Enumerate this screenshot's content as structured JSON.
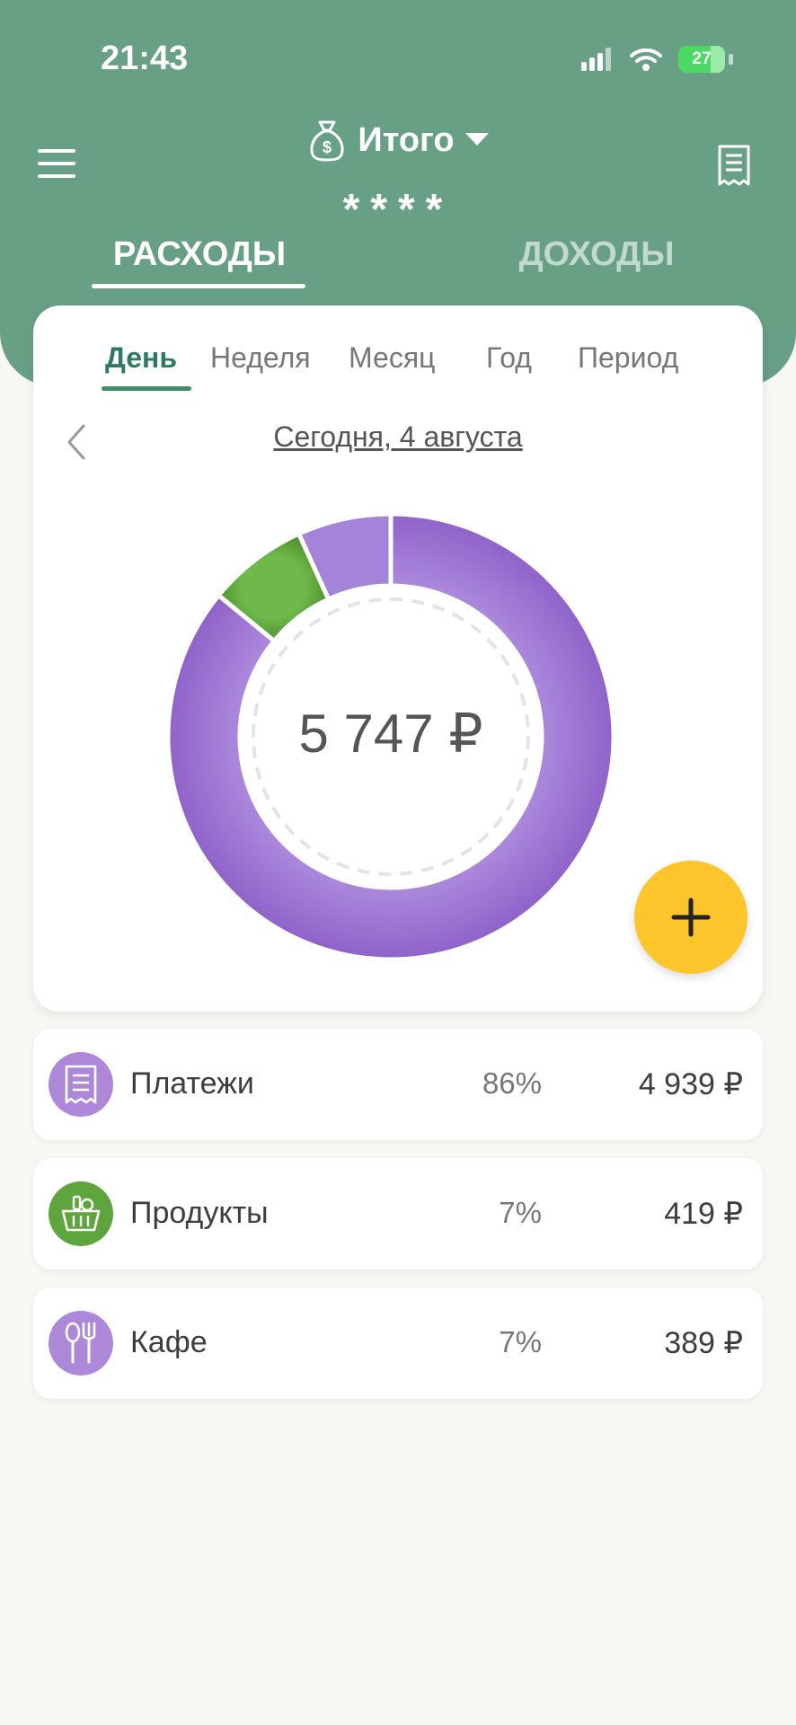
{
  "status_bar": {
    "time": "21:43",
    "battery": "27"
  },
  "header": {
    "account_name": "Итого",
    "balance_masked": "****",
    "tabs": [
      {
        "label": "РАСХОДЫ",
        "active": true
      },
      {
        "label": "ДОХОДЫ",
        "active": false
      }
    ]
  },
  "periods": [
    {
      "label": "День",
      "active": true
    },
    {
      "label": "Неделя",
      "active": false
    },
    {
      "label": "Месяц",
      "active": false
    },
    {
      "label": "Год",
      "active": false
    },
    {
      "label": "Период",
      "active": false
    }
  ],
  "date_label": "Сегодня, 4 августа",
  "total": "5 747 ₽",
  "categories": [
    {
      "name": "Платежи",
      "percent": "86%",
      "amount": "4 939 ₽",
      "color": "#ad88d8",
      "icon": "receipt-icon"
    },
    {
      "name": "Продукты",
      "percent": "7%",
      "amount": "419 ₽",
      "color": "#5ea53d",
      "icon": "grocery-basket-icon"
    },
    {
      "name": "Кафе",
      "percent": "7%",
      "amount": "389 ₽",
      "color": "#ad88d8",
      "icon": "cutlery-icon"
    }
  ],
  "chart_data": {
    "type": "pie",
    "categories": [
      "Платежи",
      "Продукты",
      "Кафе"
    ],
    "values": [
      4939,
      419,
      389
    ],
    "colors": [
      "#9b72d0",
      "#5a9e3a",
      "#a07dd4"
    ]
  },
  "colors": {
    "header": "#67a085",
    "accent": "#2e7a5c",
    "fab": "#fbc52b"
  }
}
